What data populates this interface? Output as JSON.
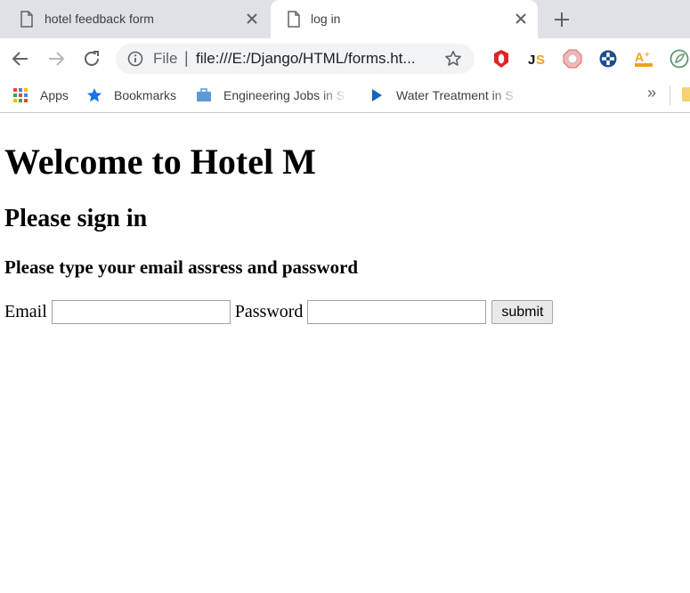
{
  "tabs": [
    {
      "title": "hotel feedback form",
      "active": false
    },
    {
      "title": "log in",
      "active": true
    }
  ],
  "toolbar": {
    "scheme_label": "File",
    "separator": "|",
    "url": "file:///E:/Django/HTML/forms.ht..."
  },
  "bookmarks": {
    "items": [
      {
        "label": "Apps",
        "icon": "apps-grid-icon"
      },
      {
        "label": "Bookmarks",
        "icon": "star-icon"
      },
      {
        "label": "Engineering Jobs in S",
        "icon": "briefcase-icon"
      },
      {
        "label": "Water Treatment in S",
        "icon": "play-icon"
      }
    ],
    "overflow_label": "»"
  },
  "page": {
    "heading": "Welcome to Hotel M",
    "subheading": "Please sign in",
    "instruction": "Please type your email assress and password",
    "email_label": "Email",
    "email_value": "",
    "password_label": "Password",
    "password_value": "",
    "submit_label": "submit"
  },
  "colors": {
    "tabstrip_bg": "#dee1e6",
    "omnibox_bg": "#f1f3f4",
    "accent_blue": "#1a73e8"
  }
}
